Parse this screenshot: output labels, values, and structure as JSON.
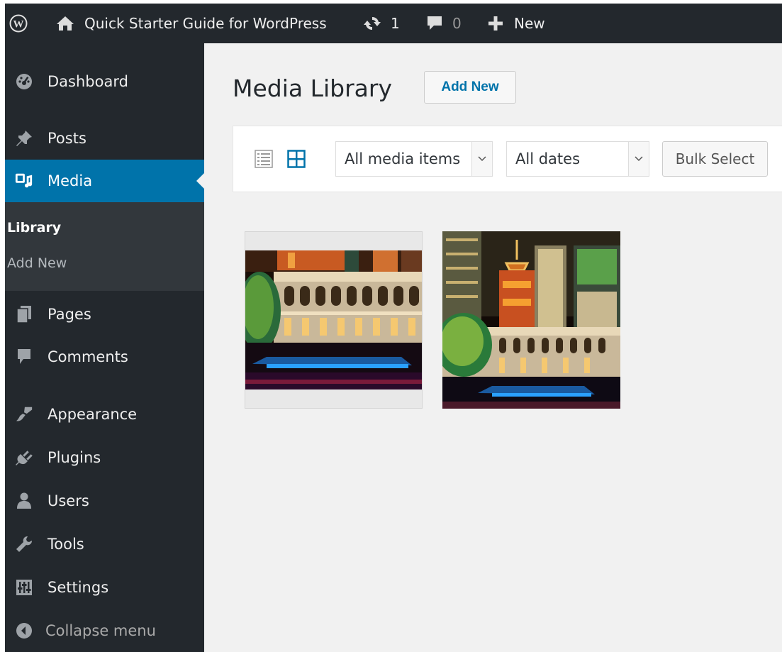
{
  "admin_bar": {
    "site_name": "Quick Starter Guide for WordPress",
    "updates_count": "1",
    "comments_count": "0",
    "new_label": "New"
  },
  "sidebar": {
    "items": [
      {
        "label": "Dashboard",
        "icon": "dashboard-icon"
      },
      {
        "label": "Posts",
        "icon": "pin-icon"
      },
      {
        "label": "Media",
        "icon": "media-icon",
        "active": true
      },
      {
        "label": "Pages",
        "icon": "pages-icon"
      },
      {
        "label": "Comments",
        "icon": "comment-icon"
      },
      {
        "label": "Appearance",
        "icon": "brush-icon"
      },
      {
        "label": "Plugins",
        "icon": "plugin-icon"
      },
      {
        "label": "Users",
        "icon": "user-icon"
      },
      {
        "label": "Tools",
        "icon": "wrench-icon"
      },
      {
        "label": "Settings",
        "icon": "settings-icon"
      },
      {
        "label": "Collapse menu",
        "icon": "collapse-icon"
      }
    ],
    "media_submenu": [
      {
        "label": "Library",
        "current": true
      },
      {
        "label": "Add New"
      }
    ]
  },
  "main": {
    "title": "Media Library",
    "add_new_label": "Add New",
    "filters": {
      "type_selected": "All media items",
      "date_selected": "All dates"
    },
    "bulk_select_label": "Bulk Select"
  },
  "colors": {
    "adminbar_bg": "#23282d",
    "accent": "#0073aa",
    "content_bg": "#f1f1f1"
  }
}
